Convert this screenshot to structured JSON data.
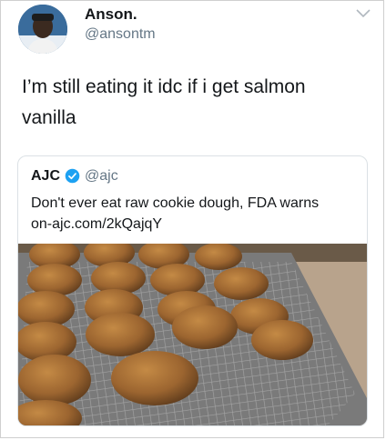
{
  "author": {
    "name": "Anson.",
    "handle": "@ansontm"
  },
  "tweet": {
    "text": "I’m still eating it idc if i get salmon vanilla"
  },
  "quoted": {
    "name": "AJC",
    "handle": "@ajc",
    "headline": "Don't ever eat raw cookie dough, FDA warns",
    "link": "on-ajc.com/2kQajqY"
  },
  "icons": [
    "avatar",
    "chevron-down-icon",
    "verified-badge-icon"
  ],
  "colors": {
    "secondary_text": "#657786",
    "verified": "#1da1f2",
    "border": "#dbe1e5"
  }
}
